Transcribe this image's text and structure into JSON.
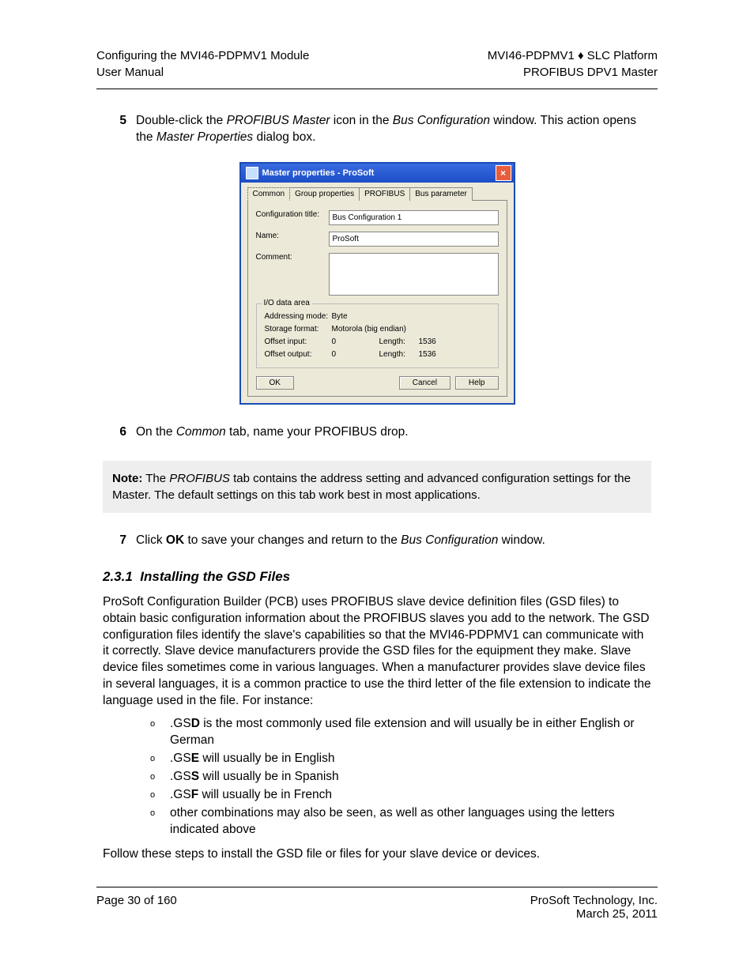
{
  "header": {
    "left_line1": "Configuring the MVI46-PDPMV1 Module",
    "left_line2": "User Manual",
    "right_line1": "MVI46-PDPMV1 ♦ SLC Platform",
    "right_line2": "PROFIBUS DPV1 Master"
  },
  "step5": {
    "num": "5",
    "pre": "Double-click the ",
    "it1": "PROFIBUS Master",
    "mid1": " icon in the ",
    "it2": "Bus Configuration",
    "mid2": " window. This action opens the ",
    "it3": "Master Properties",
    "post": " dialog box."
  },
  "dialog": {
    "title": "Master properties - ProSoft",
    "tabs": [
      "Common",
      "Group properties",
      "PROFIBUS",
      "Bus parameter"
    ],
    "labels": {
      "config_title": "Configuration title:",
      "name": "Name:",
      "comment": "Comment:",
      "io_area": "I/O data area",
      "addr_mode": "Addressing mode:",
      "storage": "Storage format:",
      "off_in": "Offset input:",
      "off_out": "Offset output:",
      "length": "Length:"
    },
    "values": {
      "config_title": "Bus Configuration 1",
      "name": "ProSoft",
      "comment": "",
      "addr_mode": "Byte",
      "storage": "Motorola (big endian)",
      "off_in": "0",
      "len_in": "1536",
      "off_out": "0",
      "len_out": "1536"
    },
    "btn_ok": "OK",
    "btn_cancel": "Cancel",
    "btn_help": "Help"
  },
  "step6": {
    "num": "6",
    "pre": "On the ",
    "it1": "Common",
    "post": " tab, name your PROFIBUS drop."
  },
  "note": {
    "b1": "Note:",
    "t1": " The ",
    "it1": "PROFIBUS",
    "t2": " tab contains the address setting and advanced configuration settings for the Master. The default settings on this tab work best in most applications."
  },
  "step7": {
    "num": "7",
    "t1": "Click ",
    "b1": "OK",
    "t2": " to save your changes and return to the ",
    "it1": "Bus Configuration",
    "t3": " window."
  },
  "section": {
    "num": "2.3.1",
    "title": "Installing the GSD Files"
  },
  "para1": "ProSoft Configuration Builder (PCB) uses PROFIBUS slave device definition files (GSD files) to obtain basic configuration information about the PROFIBUS slaves you add to the network. The GSD configuration files identify the slave's capabilities so that the MVI46-PDPMV1 can communicate with it correctly. Slave device manufacturers provide the GSD files for the equipment they make. Slave device files sometimes come in various languages. When a manufacturer provides slave device files in several languages, it is a common practice to use the third letter of the file extension to indicate the language used in the file. For instance:",
  "list": [
    {
      "pre": ".GS",
      "b": "D",
      "post": " is the most commonly used file extension and will usually be in either English or German"
    },
    {
      "pre": ".GS",
      "b": "E",
      "post": " will usually be in English"
    },
    {
      "pre": ".GS",
      "b": "S",
      "post": " will usually be in Spanish"
    },
    {
      "pre": ".GS",
      "b": "F",
      "post": " will usually be in French"
    },
    {
      "pre": "",
      "b": "",
      "post": "other combinations may also be seen, as well as other languages using the letters indicated above"
    }
  ],
  "para2": "Follow these steps to install the GSD file or files for your slave device or devices.",
  "footer": {
    "left": "Page 30 of 160",
    "right_line1": "ProSoft Technology, Inc.",
    "right_line2": "March 25, 2011"
  },
  "bullet": "o"
}
